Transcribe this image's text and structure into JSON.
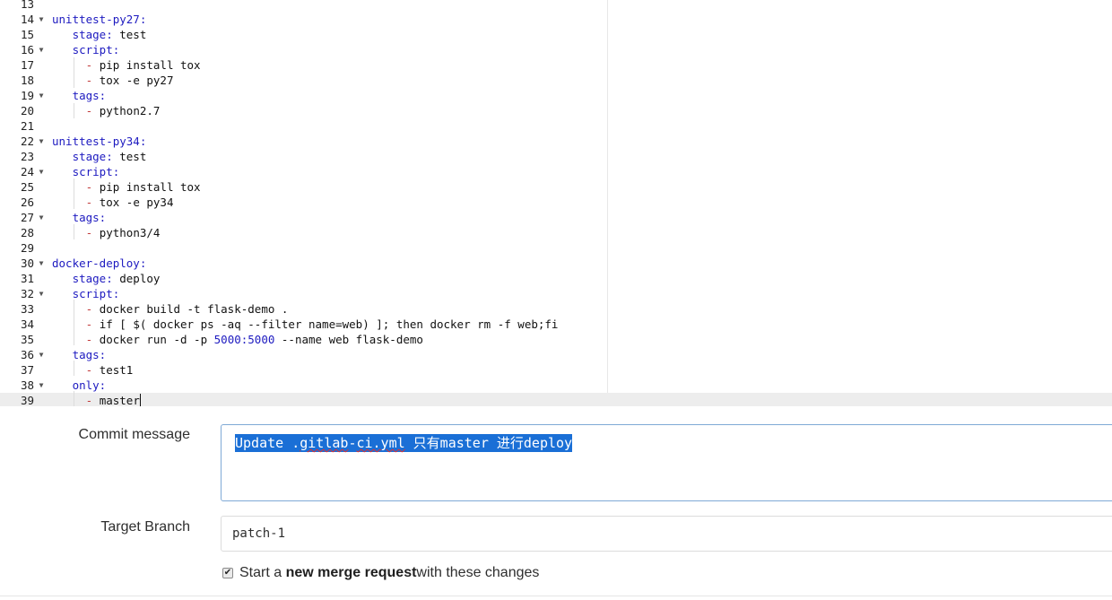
{
  "editor": {
    "lines": [
      {
        "num": "13",
        "fold": false,
        "html": ""
      },
      {
        "num": "14",
        "fold": true,
        "html": "<span class=\"k\">unittest-py27:</span>"
      },
      {
        "num": "15",
        "fold": false,
        "html": "   <span class=\"k\">stage:</span> test"
      },
      {
        "num": "16",
        "fold": true,
        "html": "   <span class=\"k\">script:</span>"
      },
      {
        "num": "17",
        "fold": false,
        "html": "     <span class=\"d\">-</span> pip install tox"
      },
      {
        "num": "18",
        "fold": false,
        "html": "     <span class=\"d\">-</span> tox -e py27"
      },
      {
        "num": "19",
        "fold": true,
        "html": "   <span class=\"k\">tags:</span>"
      },
      {
        "num": "20",
        "fold": false,
        "html": "     <span class=\"d\">-</span> python2.7"
      },
      {
        "num": "21",
        "fold": false,
        "html": ""
      },
      {
        "num": "22",
        "fold": true,
        "html": "<span class=\"k\">unittest-py34:</span>"
      },
      {
        "num": "23",
        "fold": false,
        "html": "   <span class=\"k\">stage:</span> test"
      },
      {
        "num": "24",
        "fold": true,
        "html": "   <span class=\"k\">script:</span>"
      },
      {
        "num": "25",
        "fold": false,
        "html": "     <span class=\"d\">-</span> pip install tox"
      },
      {
        "num": "26",
        "fold": false,
        "html": "     <span class=\"d\">-</span> tox -e py34"
      },
      {
        "num": "27",
        "fold": true,
        "html": "   <span class=\"k\">tags:</span>"
      },
      {
        "num": "28",
        "fold": false,
        "html": "     <span class=\"d\">-</span> python3/4"
      },
      {
        "num": "29",
        "fold": false,
        "html": ""
      },
      {
        "num": "30",
        "fold": true,
        "html": "<span class=\"k\">docker-deploy:</span>"
      },
      {
        "num": "31",
        "fold": false,
        "html": "   <span class=\"k\">stage:</span> deploy"
      },
      {
        "num": "32",
        "fold": true,
        "html": "   <span class=\"k\">script:</span>"
      },
      {
        "num": "33",
        "fold": false,
        "html": "     <span class=\"d\">-</span> docker build -t flask-demo ."
      },
      {
        "num": "34",
        "fold": false,
        "html": "     <span class=\"d\">-</span> if [ $( docker ps -aq --filter name=web) ]; then docker rm -f web;fi"
      },
      {
        "num": "35",
        "fold": false,
        "html": "     <span class=\"d\">-</span> docker run -d -p <span class=\"n\">5000:5000</span> --name web flask-demo"
      },
      {
        "num": "36",
        "fold": true,
        "html": "   <span class=\"k\">tags:</span>"
      },
      {
        "num": "37",
        "fold": false,
        "html": "     <span class=\"d\">-</span> test1"
      },
      {
        "num": "38",
        "fold": true,
        "html": "   <span class=\"k\">only:</span>"
      },
      {
        "num": "39",
        "fold": false,
        "html": "     <span class=\"d\">-</span> master"
      }
    ],
    "fold_glyph": "▼"
  },
  "form": {
    "commit_label": "Commit message",
    "commit_message": {
      "before": "Update .",
      "squiggle1": "gitlab",
      "dash": "-",
      "squiggle2": "ci.yml",
      "after": " 只有master 进行deploy"
    },
    "branch_label": "Target Branch",
    "branch_value": "patch-1",
    "merge_request": {
      "checked": true,
      "check_glyph": "✔",
      "prefix": "Start a ",
      "bold": "new merge request",
      "suffix": " with these changes"
    }
  }
}
